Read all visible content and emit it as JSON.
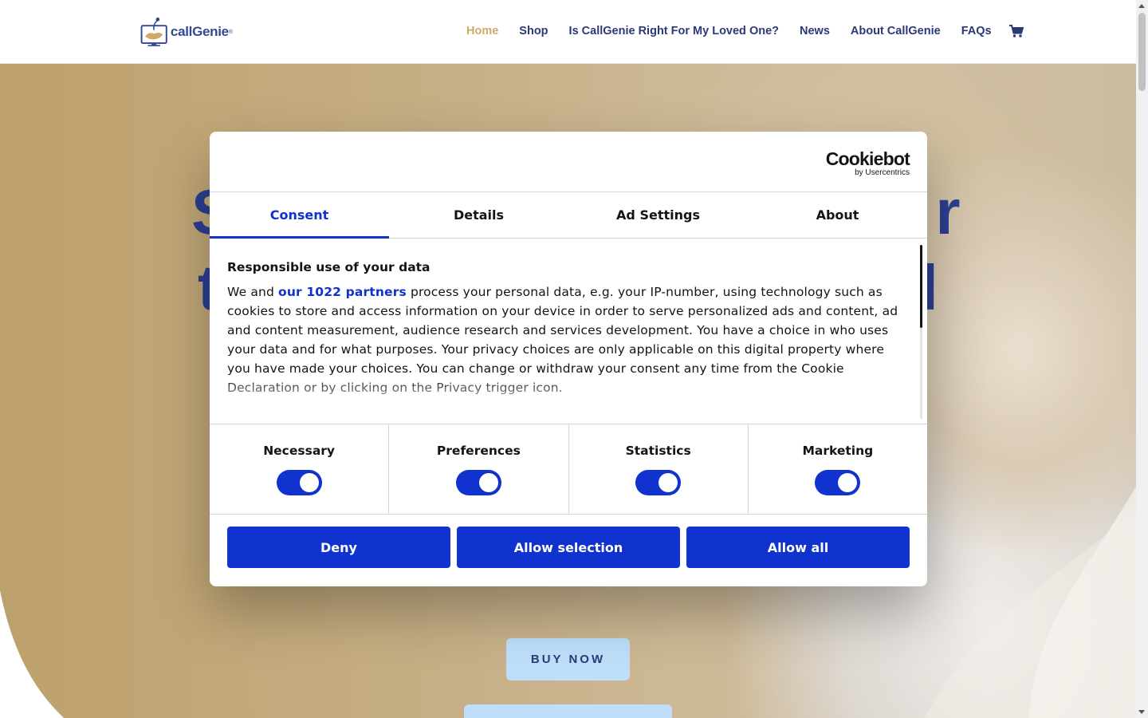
{
  "header": {
    "logo_text": "callGenie",
    "nav": [
      {
        "label": "Home",
        "active": true
      },
      {
        "label": "Shop"
      },
      {
        "label": "Is CallGenie Right For My Loved One?"
      },
      {
        "label": "News"
      },
      {
        "label": "About CallGenie"
      },
      {
        "label": "FAQs"
      }
    ],
    "cart_icon": "shopping-cart-icon"
  },
  "hero": {
    "heading_line1_left": "S",
    "heading_line1_right": "r",
    "heading_line2_left": "t",
    "heading_line2_right": "l",
    "buy_button": "BUY NOW"
  },
  "cookie_dialog": {
    "brand": "Cookiebot",
    "brand_sub": "by Usercentrics",
    "tabs": [
      {
        "label": "Consent",
        "active": true
      },
      {
        "label": "Details"
      },
      {
        "label": "Ad Settings"
      },
      {
        "label": "About"
      }
    ],
    "title": "Responsible use of your data",
    "text_prefix": "We and ",
    "partners_link": "our 1022 partners",
    "text_body": " process your personal data, e.g. your IP-number, using technology such as cookies to store and access information on your device in order to serve personalized ads and content, ad and content measurement, audience research and services development. You have a choice in who uses your data and for what purposes. Your privacy choices are only applicable on this digital property where you have made your choices. You can change or withdraw your consent any time from the Cookie Declaration or by clicking on the Privacy trigger icon.",
    "toggles": [
      {
        "label": "Necessary",
        "on": true
      },
      {
        "label": "Preferences",
        "on": true
      },
      {
        "label": "Statistics",
        "on": true
      },
      {
        "label": "Marketing",
        "on": true
      }
    ],
    "buttons": {
      "deny": "Deny",
      "allow_selection": "Allow selection",
      "allow_all": "Allow all"
    }
  },
  "colors": {
    "brand_blue": "#1032cf",
    "nav_active": "#c9a35a",
    "nav_text": "#1a2a6c",
    "hero_gold": "#b99d66",
    "button_light": "#b9dcfa"
  }
}
